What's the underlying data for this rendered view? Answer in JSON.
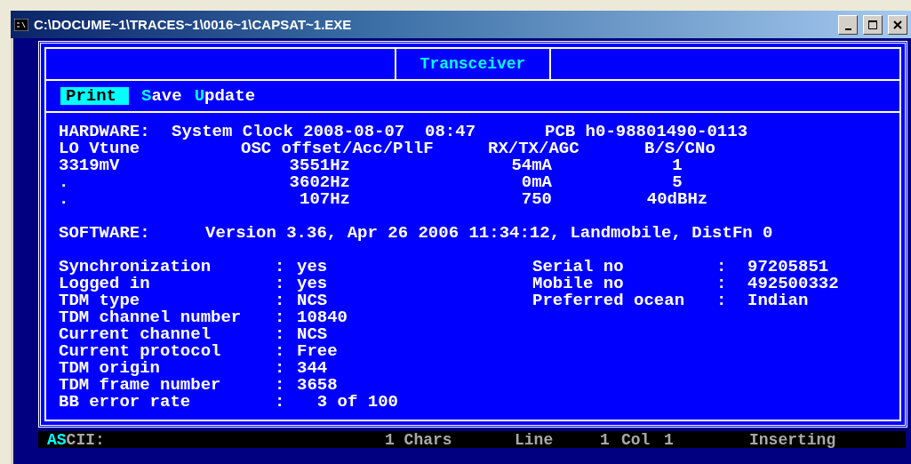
{
  "window": {
    "title": "C:\\DOCUME~1\\TRACES~1\\0016~1\\CAPSAT~1.EXE"
  },
  "panel_title": "Transceiver",
  "menu": [
    {
      "hotkey": "P",
      "rest": "rint",
      "selected": true
    },
    {
      "hotkey": "S",
      "rest": "ave",
      "selected": false
    },
    {
      "hotkey": "U",
      "rest": "pdate",
      "selected": false
    }
  ],
  "hardware": {
    "label": "HARDWARE:",
    "clock": "System Clock 2008-08-07  08:47",
    "pcb": "PCB h0-98801490-0113",
    "columns": [
      "LO Vtune",
      "OSC offset/Acc/PllF",
      "RX/TX/AGC",
      "B/S/CNo"
    ],
    "rows": [
      [
        "3319mV",
        "3551Hz",
        "54mA",
        "1"
      ],
      [
        ".",
        "3602Hz",
        "0mA",
        "5"
      ],
      [
        ".",
        "107Hz",
        "750",
        "40dBHz"
      ]
    ]
  },
  "software": {
    "label": "SOFTWARE:",
    "version": "Version 3.36, Apr 26 2006 11:34:12, Landmobile, DistFn 0"
  },
  "status": [
    {
      "label": "Synchronization",
      "separator": ":",
      "value": "yes"
    },
    {
      "label": "Logged in",
      "separator": ":",
      "value": "yes"
    },
    {
      "label": "TDM type",
      "separator": ":",
      "value": "NCS"
    },
    {
      "label": "TDM channel number",
      "separator": ":",
      "value": "10840"
    },
    {
      "label": "Current channel",
      "separator": ":",
      "value": "NCS"
    },
    {
      "label": "Current protocol",
      "separator": ":",
      "value": "Free"
    },
    {
      "label": "TDM origin",
      "separator": ":",
      "value": "344"
    },
    {
      "label": "TDM frame number",
      "separator": ":",
      "value": "3658"
    },
    {
      "label": "BB error rate",
      "separator": ":",
      "value": "  3 of 100"
    }
  ],
  "identity": [
    {
      "label": "Serial no",
      "separator": ":",
      "value": "97205851"
    },
    {
      "label": "Mobile no",
      "separator": ":",
      "value": "492500332"
    },
    {
      "label": "Preferred ocean",
      "separator": ":",
      "value": "Indian"
    }
  ],
  "status_bar": {
    "mode": [
      {
        "text": "AS",
        "highlighted": true
      },
      {
        "text": "CII:",
        "highlighted": false
      }
    ],
    "chars": "1 Chars",
    "line_label": "Line",
    "line": "1",
    "col_label": "Col",
    "col": "1",
    "insert_mode": "Inserting"
  }
}
